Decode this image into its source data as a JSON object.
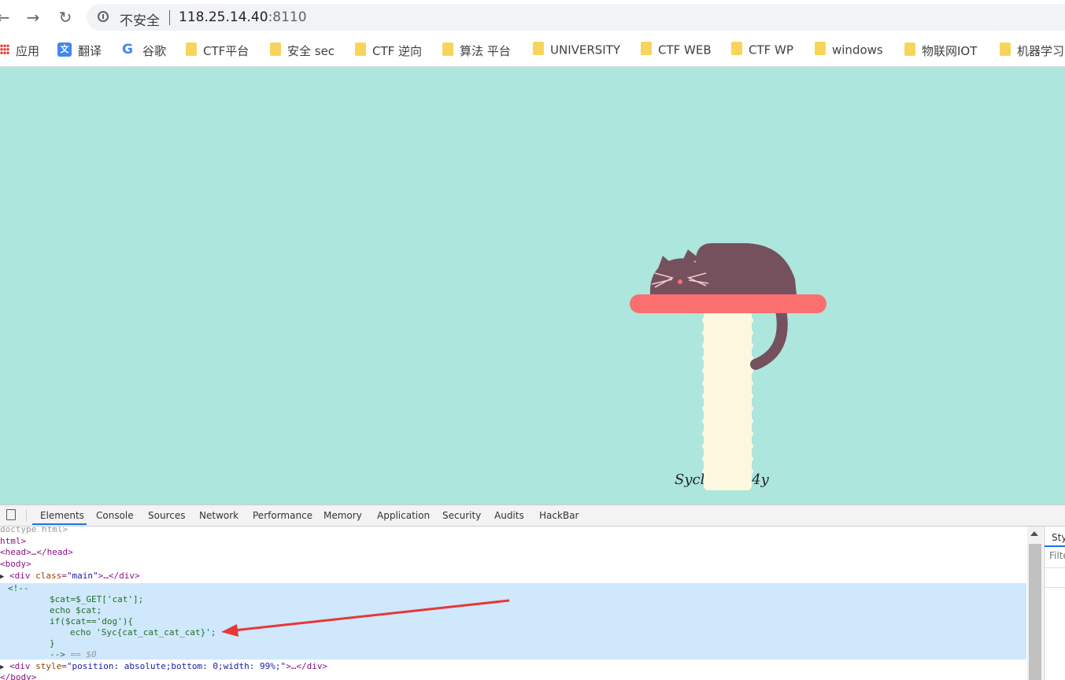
{
  "browser": {
    "security_label": "不安全",
    "url_host": "118.25.14.40",
    "url_port": ":8110"
  },
  "bookmarks": [
    {
      "label": "应用",
      "icon": "apps-icon"
    },
    {
      "label": "翻译",
      "icon": "translate-icon"
    },
    {
      "label": "谷歌",
      "icon": "google-icon"
    },
    {
      "label": "CTF平台",
      "icon": "folder-icon"
    },
    {
      "label": "安全 sec",
      "icon": "folder-icon"
    },
    {
      "label": "CTF 逆向",
      "icon": "folder-icon"
    },
    {
      "label": "算法 平台",
      "icon": "folder-icon"
    },
    {
      "label": "UNIVERSITY",
      "icon": "folder-icon"
    },
    {
      "label": "CTF WEB",
      "icon": "folder-icon"
    },
    {
      "label": "CTF WP",
      "icon": "folder-icon"
    },
    {
      "label": "windows",
      "icon": "folder-icon"
    },
    {
      "label": "物联网IOT",
      "icon": "folder-icon"
    },
    {
      "label": "机器学习",
      "icon": "folder-icon"
    }
  ],
  "page": {
    "signature_left": "Sycl",
    "signature_right": "cl4y"
  },
  "colors": {
    "page_background": "#ade6dc",
    "cat": "#75515e",
    "shelf": "#fb6f6f",
    "post": "#fcf8e0"
  },
  "devtools": {
    "tabs": [
      "Elements",
      "Console",
      "Sources",
      "Network",
      "Performance",
      "Memory",
      "Application",
      "Security",
      "Audits",
      "HackBar"
    ],
    "active_tab": "Elements",
    "styles_tab": "Styl",
    "filter_placeholder": "Filte",
    "code": {
      "doctype": "doctype html>",
      "html_open": "html>",
      "head": "<head>…</head>",
      "body_open": "<body>",
      "div_main_tag": "<div ",
      "div_main_attr": "class",
      "div_main_val": "\"main\"",
      "div_main_rest": ">…</div>",
      "comment_open": "<!--",
      "php_1": "$cat=$_GET['cat'];",
      "php_2": "echo $cat;",
      "php_3": "if($cat=='dog'){",
      "php_4": "echo 'Syc{cat_cat_cat_cat}';",
      "php_5": "}",
      "comment_close": "-->",
      "selected_marker": "== $0",
      "div_style_tag": "<div ",
      "div_style_attr": "style",
      "div_style_val": "\"position: absolute;bottom: 0;width: 99%;\"",
      "div_style_rest": ">…</div>",
      "body_close": "</body>"
    }
  }
}
